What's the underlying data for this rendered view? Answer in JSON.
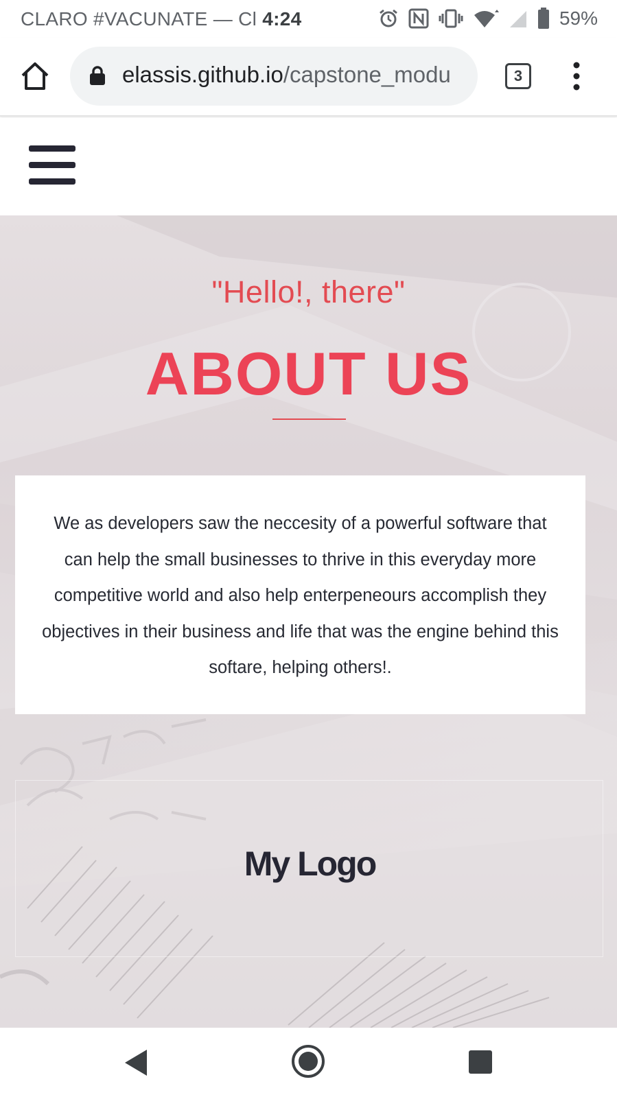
{
  "status_bar": {
    "carrier": "CLARO #VACUNATE — Cl",
    "time": "4:24",
    "battery": "59%",
    "icons": [
      "alarm-icon",
      "nfc-icon",
      "vibrate-icon",
      "wifi-icon",
      "signal-icon",
      "battery-icon"
    ]
  },
  "browser": {
    "url_host": "elassis.github.io",
    "url_path": "/capstone_modu",
    "tab_count": "3",
    "icons": [
      "home-icon",
      "lock-icon",
      "tabs-icon",
      "more-vert-icon"
    ]
  },
  "site": {
    "menu_icon": "hamburger-icon",
    "hero": {
      "greeting": "\"Hello!, there\"",
      "title": "ABOUT US",
      "description": "We as developers saw the neccesity of a powerful software that can help the small businesses to thrive in this everyday more competitive world and also help enterpeneours accomplish they objectives in their business and life that was the engine behind this softare, helping others!.",
      "logo": "My Logo"
    }
  },
  "nav_bar": {
    "icons": [
      "back-icon",
      "home-circle-icon",
      "recents-icon"
    ]
  },
  "colors": {
    "accent": "#ec4356",
    "greeting": "#e34b52",
    "dark_text": "#262633",
    "hero_bg": "#e2dcde"
  }
}
